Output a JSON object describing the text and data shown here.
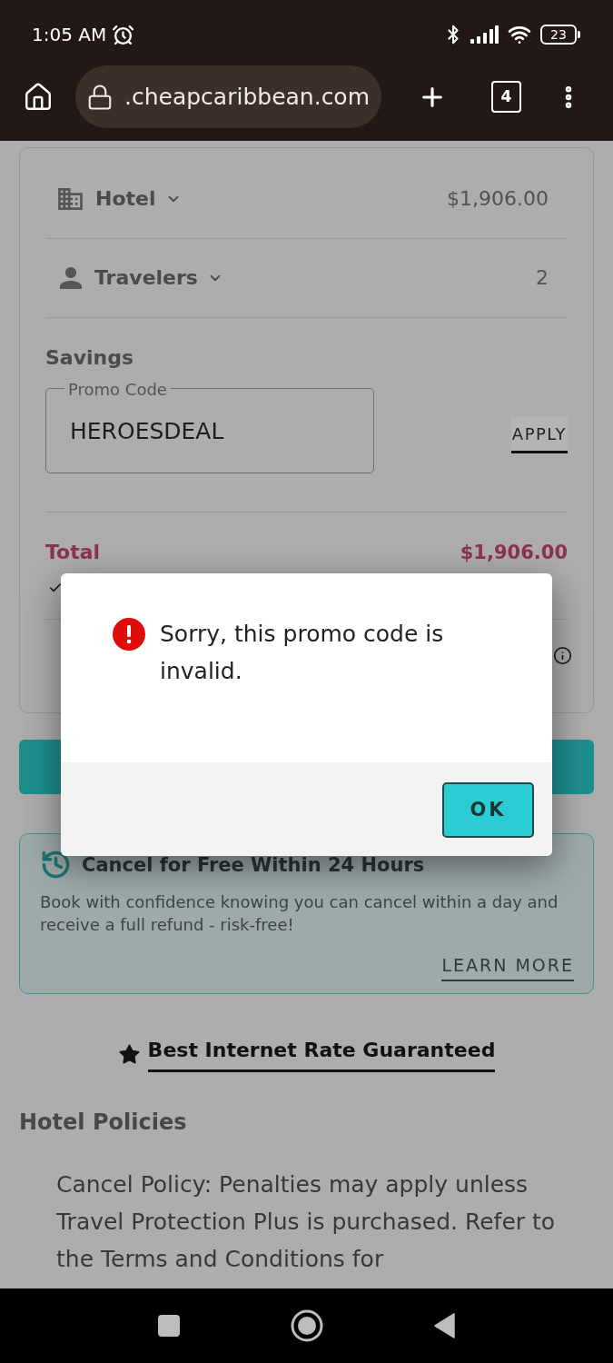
{
  "status_bar": {
    "time": "1:05 AM",
    "battery": "23"
  },
  "browser_bar": {
    "url": ".cheapcaribbean.com",
    "tab_count": "4"
  },
  "summary": {
    "rows": [
      {
        "kind": "hotel",
        "label": "Hotel",
        "value": "$1,906.00",
        "expanded": false
      },
      {
        "kind": "travelers",
        "label": "Travelers",
        "value": "2",
        "expanded": false
      }
    ],
    "savings": {
      "title": "Savings",
      "promo_field": {
        "label": "Promo Code",
        "value": "HEROESDEAL"
      },
      "apply": "APPLY"
    },
    "total": {
      "label": "Total",
      "value": "$1,906.00"
    }
  },
  "cancel_banner": {
    "title": "Cancel for Free Within 24 Hours",
    "text": "Book with confidence knowing you can cancel within a day and receive a full refund - risk-free!",
    "link": "LEARN MORE"
  },
  "guarantee": {
    "text": "Best Internet Rate Guaranteed"
  },
  "hotel_policies": {
    "title": "Hotel Policies",
    "text": "Cancel Policy: Penalties may apply unless Travel Protection Plus is purchased. Refer to the Terms and Conditions for"
  },
  "dialog": {
    "message": "Sorry, this promo code is invalid.",
    "button": "OK"
  }
}
